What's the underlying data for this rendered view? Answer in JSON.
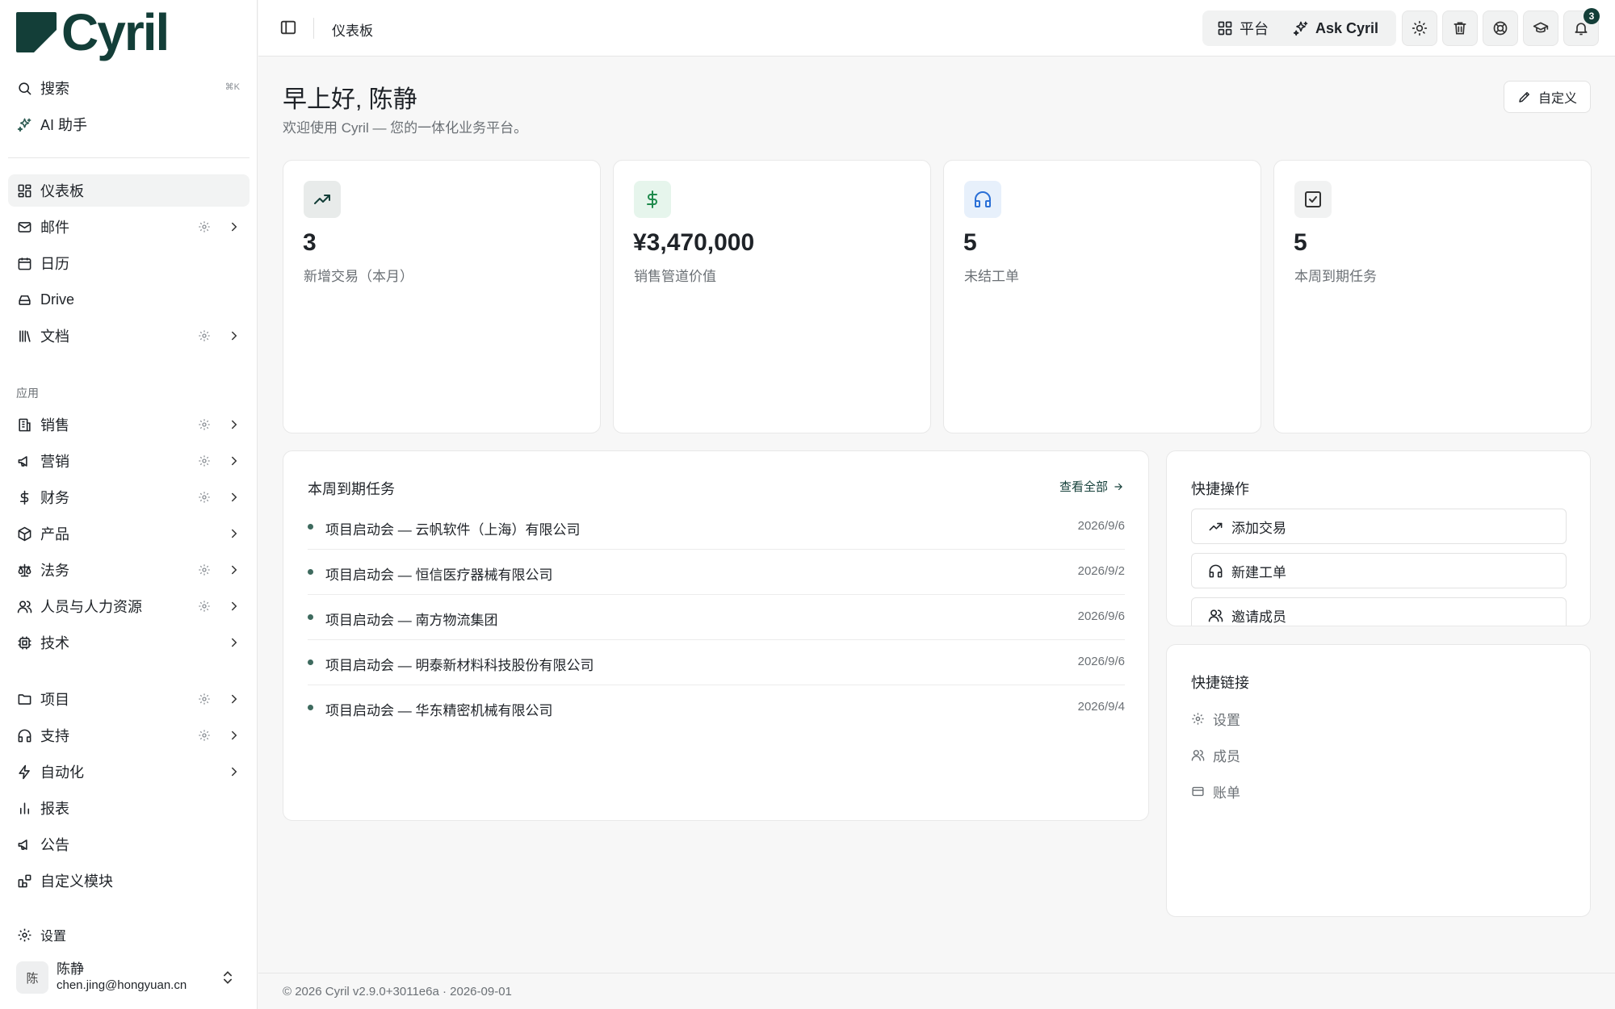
{
  "brand": {
    "name": "Cyril"
  },
  "sidebar": {
    "search": {
      "label": "搜索",
      "shortcut": "⌘K"
    },
    "ai": {
      "label": "AI 助手"
    },
    "main_items": [
      {
        "label": "仪表板",
        "icon": "dashboard-icon",
        "active": true
      },
      {
        "label": "邮件",
        "icon": "mail-icon"
      },
      {
        "label": "日历",
        "icon": "calendar-icon"
      },
      {
        "label": "Drive",
        "icon": "drive-icon"
      },
      {
        "label": "文档",
        "icon": "library-icon"
      }
    ],
    "apps_label": "应用",
    "app_items": [
      {
        "label": "销售",
        "icon": "building-icon"
      },
      {
        "label": "营销",
        "icon": "megaphone-icon"
      },
      {
        "label": "财务",
        "icon": "dollar-icon"
      },
      {
        "label": "产品",
        "icon": "package-icon"
      },
      {
        "label": "法务",
        "icon": "scale-icon"
      },
      {
        "label": "人员与人力资源",
        "icon": "users-icon"
      },
      {
        "label": "技术",
        "icon": "cpu-icon"
      }
    ],
    "other_items": [
      {
        "label": "项目",
        "icon": "folder-icon"
      },
      {
        "label": "支持",
        "icon": "headphones-icon"
      },
      {
        "label": "自动化",
        "icon": "zap-icon"
      },
      {
        "label": "报表",
        "icon": "bar-chart-icon"
      },
      {
        "label": "公告",
        "icon": "megaphone-icon"
      },
      {
        "label": "自定义模块",
        "icon": "blocks-icon"
      }
    ],
    "settings": {
      "label": "设置"
    },
    "user": {
      "initial": "陈",
      "name": "陈静",
      "email": "chen.jing@hongyuan.cn"
    }
  },
  "header": {
    "title": "仪表板",
    "platform_label": "平台",
    "ask_label": "Ask Cyril",
    "notification_count": "3"
  },
  "main": {
    "greeting": "早上好, 陈静",
    "subtitle": "欢迎使用 Cyril — 您的一体化业务平台。",
    "customize_label": "自定义",
    "stats": [
      {
        "value": "3",
        "label": "新增交易（本月）",
        "icon": "trending-up-icon",
        "accent": "#e8ebea"
      },
      {
        "value": "¥3,470,000",
        "label": "销售管道价值",
        "icon": "dollar-icon",
        "accent": "#e6f5ec"
      },
      {
        "value": "5",
        "label": "未结工单",
        "icon": "headphones-icon",
        "accent": "#e7f0fb"
      },
      {
        "value": "5",
        "label": "本周到期任务",
        "icon": "check-square-icon",
        "accent": "#f1f2f2"
      }
    ],
    "tasks": {
      "title": "本周到期任务",
      "view_all": "查看全部",
      "items": [
        {
          "title": "项目启动会 — 云帆软件（上海）有限公司",
          "date": "2026/9/6"
        },
        {
          "title": "项目启动会 — 恒信医疗器械有限公司",
          "date": "2026/9/2"
        },
        {
          "title": "项目启动会 — 南方物流集团",
          "date": "2026/9/6"
        },
        {
          "title": "项目启动会 — 明泰新材料科技股份有限公司",
          "date": "2026/9/6"
        },
        {
          "title": "项目启动会 — 华东精密机械有限公司",
          "date": "2026/9/4"
        }
      ]
    },
    "quick_actions": {
      "title": "快捷操作",
      "items": [
        {
          "label": "添加交易",
          "icon": "trending-up-icon"
        },
        {
          "label": "新建工单",
          "icon": "headphones-icon"
        },
        {
          "label": "邀请成员",
          "icon": "users-icon"
        }
      ]
    },
    "quick_links": {
      "title": "快捷链接",
      "items": [
        {
          "label": "设置",
          "icon": "gear-icon"
        },
        {
          "label": "成员",
          "icon": "users-icon"
        },
        {
          "label": "账单",
          "icon": "credit-card-icon"
        }
      ]
    }
  },
  "footer": {
    "text": "© 2026 Cyril v2.9.0+3011e6a · 2026-09-01"
  },
  "colors": {
    "brand": "#133e38",
    "stat_dollar": "#1f8a4c",
    "stat_headset": "#2a6fd6"
  }
}
